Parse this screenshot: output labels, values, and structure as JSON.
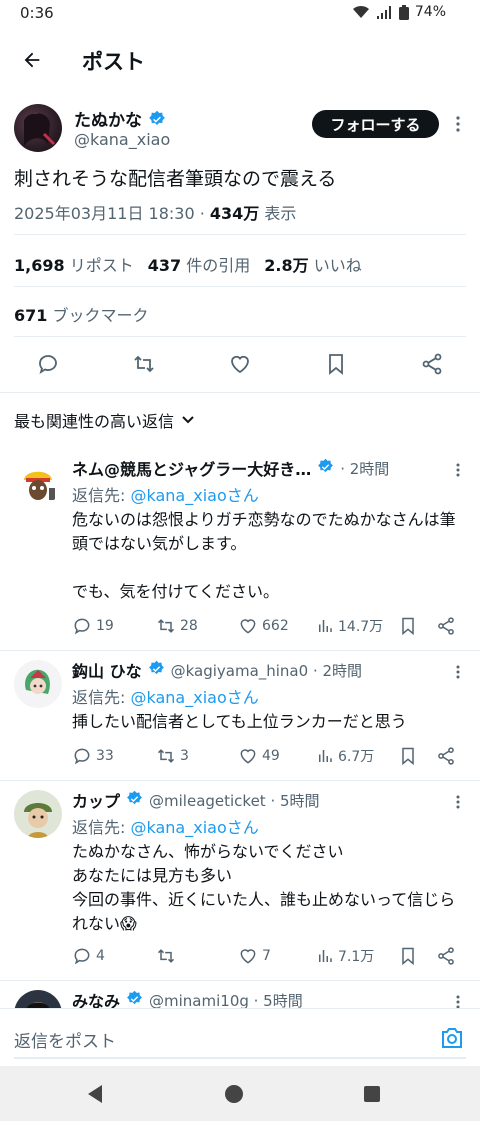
{
  "status": {
    "time": "0:36",
    "battery": "74%"
  },
  "header": {
    "title": "ポスト"
  },
  "post": {
    "author_name": "たぬかな",
    "author_handle": "@kana_xiao",
    "follow_label": "フォローする",
    "text": "刺されそうな配信者筆頭なので震える",
    "datetime": "2025年03月11日 18:30 · ",
    "views": "434万",
    "views_label": " 表示",
    "stats": {
      "reposts": "1,698",
      "reposts_label": "リポスト",
      "quotes": "437",
      "quotes_label": "件の引用",
      "likes": "2.8万",
      "likes_label": "いいね",
      "bookmarks": "671",
      "bookmarks_label": "ブックマーク"
    }
  },
  "sort": {
    "label": "最も関連性の高い返信"
  },
  "replies": [
    {
      "name": "ネム@競馬とジャグラー大好き…",
      "meta": "· 2時間",
      "reply_to_label": "返信先: ",
      "reply_to_handle": "@kana_xiaoさん",
      "text": "危ないのは怨恨よりガチ恋勢なのでたぬかなさんは筆頭ではない気がします。\n\nでも、気を付けてください。",
      "replies": "19",
      "reposts": "28",
      "likes": "662",
      "views": "14.7万"
    },
    {
      "name": "鈎山 ひな",
      "meta": "@kagiyama_hina0 · 2時間",
      "reply_to_label": "返信先: ",
      "reply_to_handle": "@kana_xiaoさん",
      "text": "挿したい配信者としても上位ランカーだと思う",
      "replies": "33",
      "reposts": "3",
      "likes": "49",
      "views": "6.7万"
    },
    {
      "name": "カップ",
      "meta": "@mileageticket · 5時間",
      "reply_to_label": "返信先: ",
      "reply_to_handle": "@kana_xiaoさん",
      "text": "たぬかなさん、怖がらないでください\nあなたには見方も多い\n今回の事件、近くにいた人、誰も止めないって信じられない😱",
      "replies": "4",
      "reposts": "",
      "likes": "7",
      "views": "7.1万"
    },
    {
      "name": "みなみ",
      "meta": "@minami10g · 5時間"
    }
  ],
  "compose": {
    "placeholder": "返信をポスト"
  },
  "colors": {
    "accent": "#1d9bf0",
    "text": "#0f1419",
    "muted": "#536471"
  }
}
